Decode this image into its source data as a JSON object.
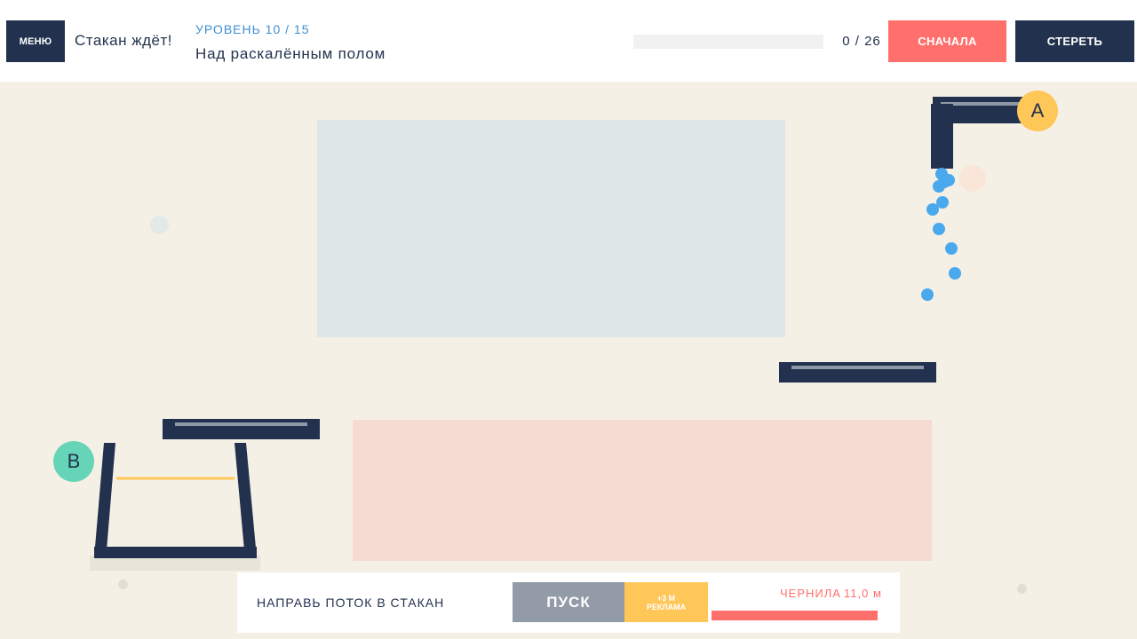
{
  "header": {
    "menu_label": "МЕНЮ",
    "game_title": "Стакан ждёт!",
    "level_label": "УРОВЕНЬ 10 / 15",
    "level_name": "Над раскалённым полом",
    "counter": "0 / 26",
    "fill_progress": 0,
    "restart_label": "СНАЧАЛА",
    "erase_label": "СТЕРЕТЬ"
  },
  "markers": {
    "source": "A",
    "target": "B"
  },
  "bottom": {
    "hint": "НАПРАВЬ ПОТОК В СТАКАН",
    "play_label": "ПУСК",
    "ad_line1": "+3 М",
    "ad_line2": "РЕКЛАМА",
    "ink_label": "ЧЕРНИЛА",
    "ink_value": "11,0 м",
    "ink_level": 1.0
  },
  "colors": {
    "dark": "#22324e",
    "water": "#4aa8ec",
    "accent_red": "#ff6f6c",
    "accent_yellow": "#ffc658",
    "accent_teal": "#66d4b6",
    "background": "#f5f0e6"
  }
}
